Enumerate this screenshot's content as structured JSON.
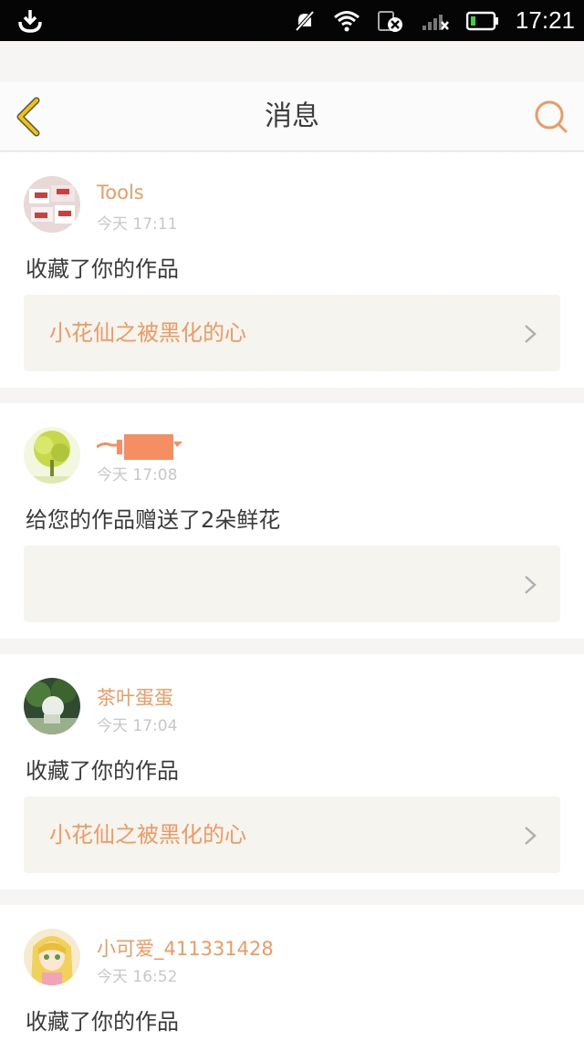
{
  "status_bar": {
    "time": "17:21",
    "icons": [
      "download-icon",
      "mute-icon",
      "wifi-icon",
      "sim-icon",
      "signal-icon",
      "battery-icon"
    ]
  },
  "header": {
    "title": "消息",
    "back_icon": "chevron-left-icon",
    "search_icon": "search-icon"
  },
  "colors": {
    "accent": "#ef9a62",
    "back_arrow": "#f2c500",
    "card_link_bg": "#f5f4ef",
    "redaction": "#f58f63"
  },
  "messages": [
    {
      "username": "Tools",
      "time": "今天 17:11",
      "action": "收藏了你的作品",
      "work_title": "小花仙之被黑化的心"
    },
    {
      "username": "",
      "time": "今天 17:08",
      "action": "给您的作品赠送了2朵鲜花",
      "work_title": ""
    },
    {
      "username": "茶叶蛋蛋",
      "time": "今天 17:04",
      "action": "收藏了你的作品",
      "work_title": "小花仙之被黑化的心"
    },
    {
      "username": "小可爱_411331428",
      "time": "今天 16:52",
      "action": "收藏了你的作品"
    }
  ]
}
